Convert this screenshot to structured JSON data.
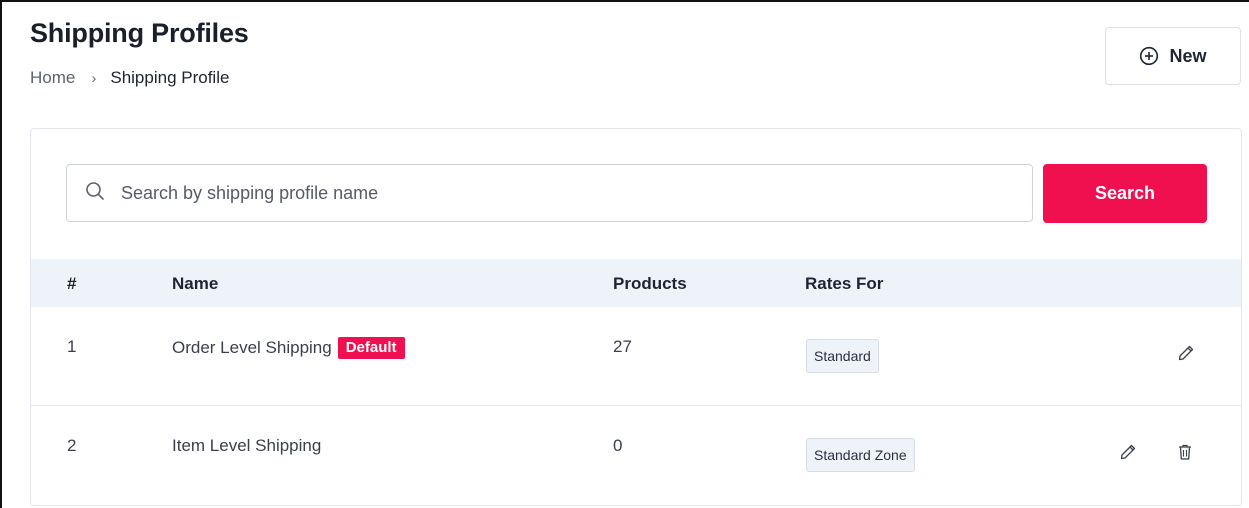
{
  "header": {
    "title": "Shipping Profiles",
    "breadcrumb": {
      "home": "Home",
      "separator": "›",
      "current": "Shipping Profile"
    },
    "new_button_label": "New"
  },
  "search": {
    "placeholder": "Search by shipping profile name",
    "button_label": "Search"
  },
  "table": {
    "columns": [
      "#",
      "Name",
      "Products",
      "Rates For"
    ],
    "rows": [
      {
        "index": "1",
        "name": "Order Level Shipping",
        "badge": "Default",
        "products": "27",
        "rates_for": "Standard",
        "actions": [
          "edit-icon"
        ]
      },
      {
        "index": "2",
        "name": "Item Level Shipping",
        "badge": "",
        "products": "0",
        "rates_for": "Standard Zone",
        "actions": [
          "edit-icon",
          "trash-icon"
        ]
      }
    ]
  },
  "colors": {
    "accent": "#f0104f",
    "table_header_bg": "#eef3fa",
    "chip_bg": "#eef3fa"
  },
  "icons": {
    "new_button": "plus-circle-icon",
    "search": "search-icon",
    "edit": "pencil-icon",
    "delete": "trash-icon"
  }
}
